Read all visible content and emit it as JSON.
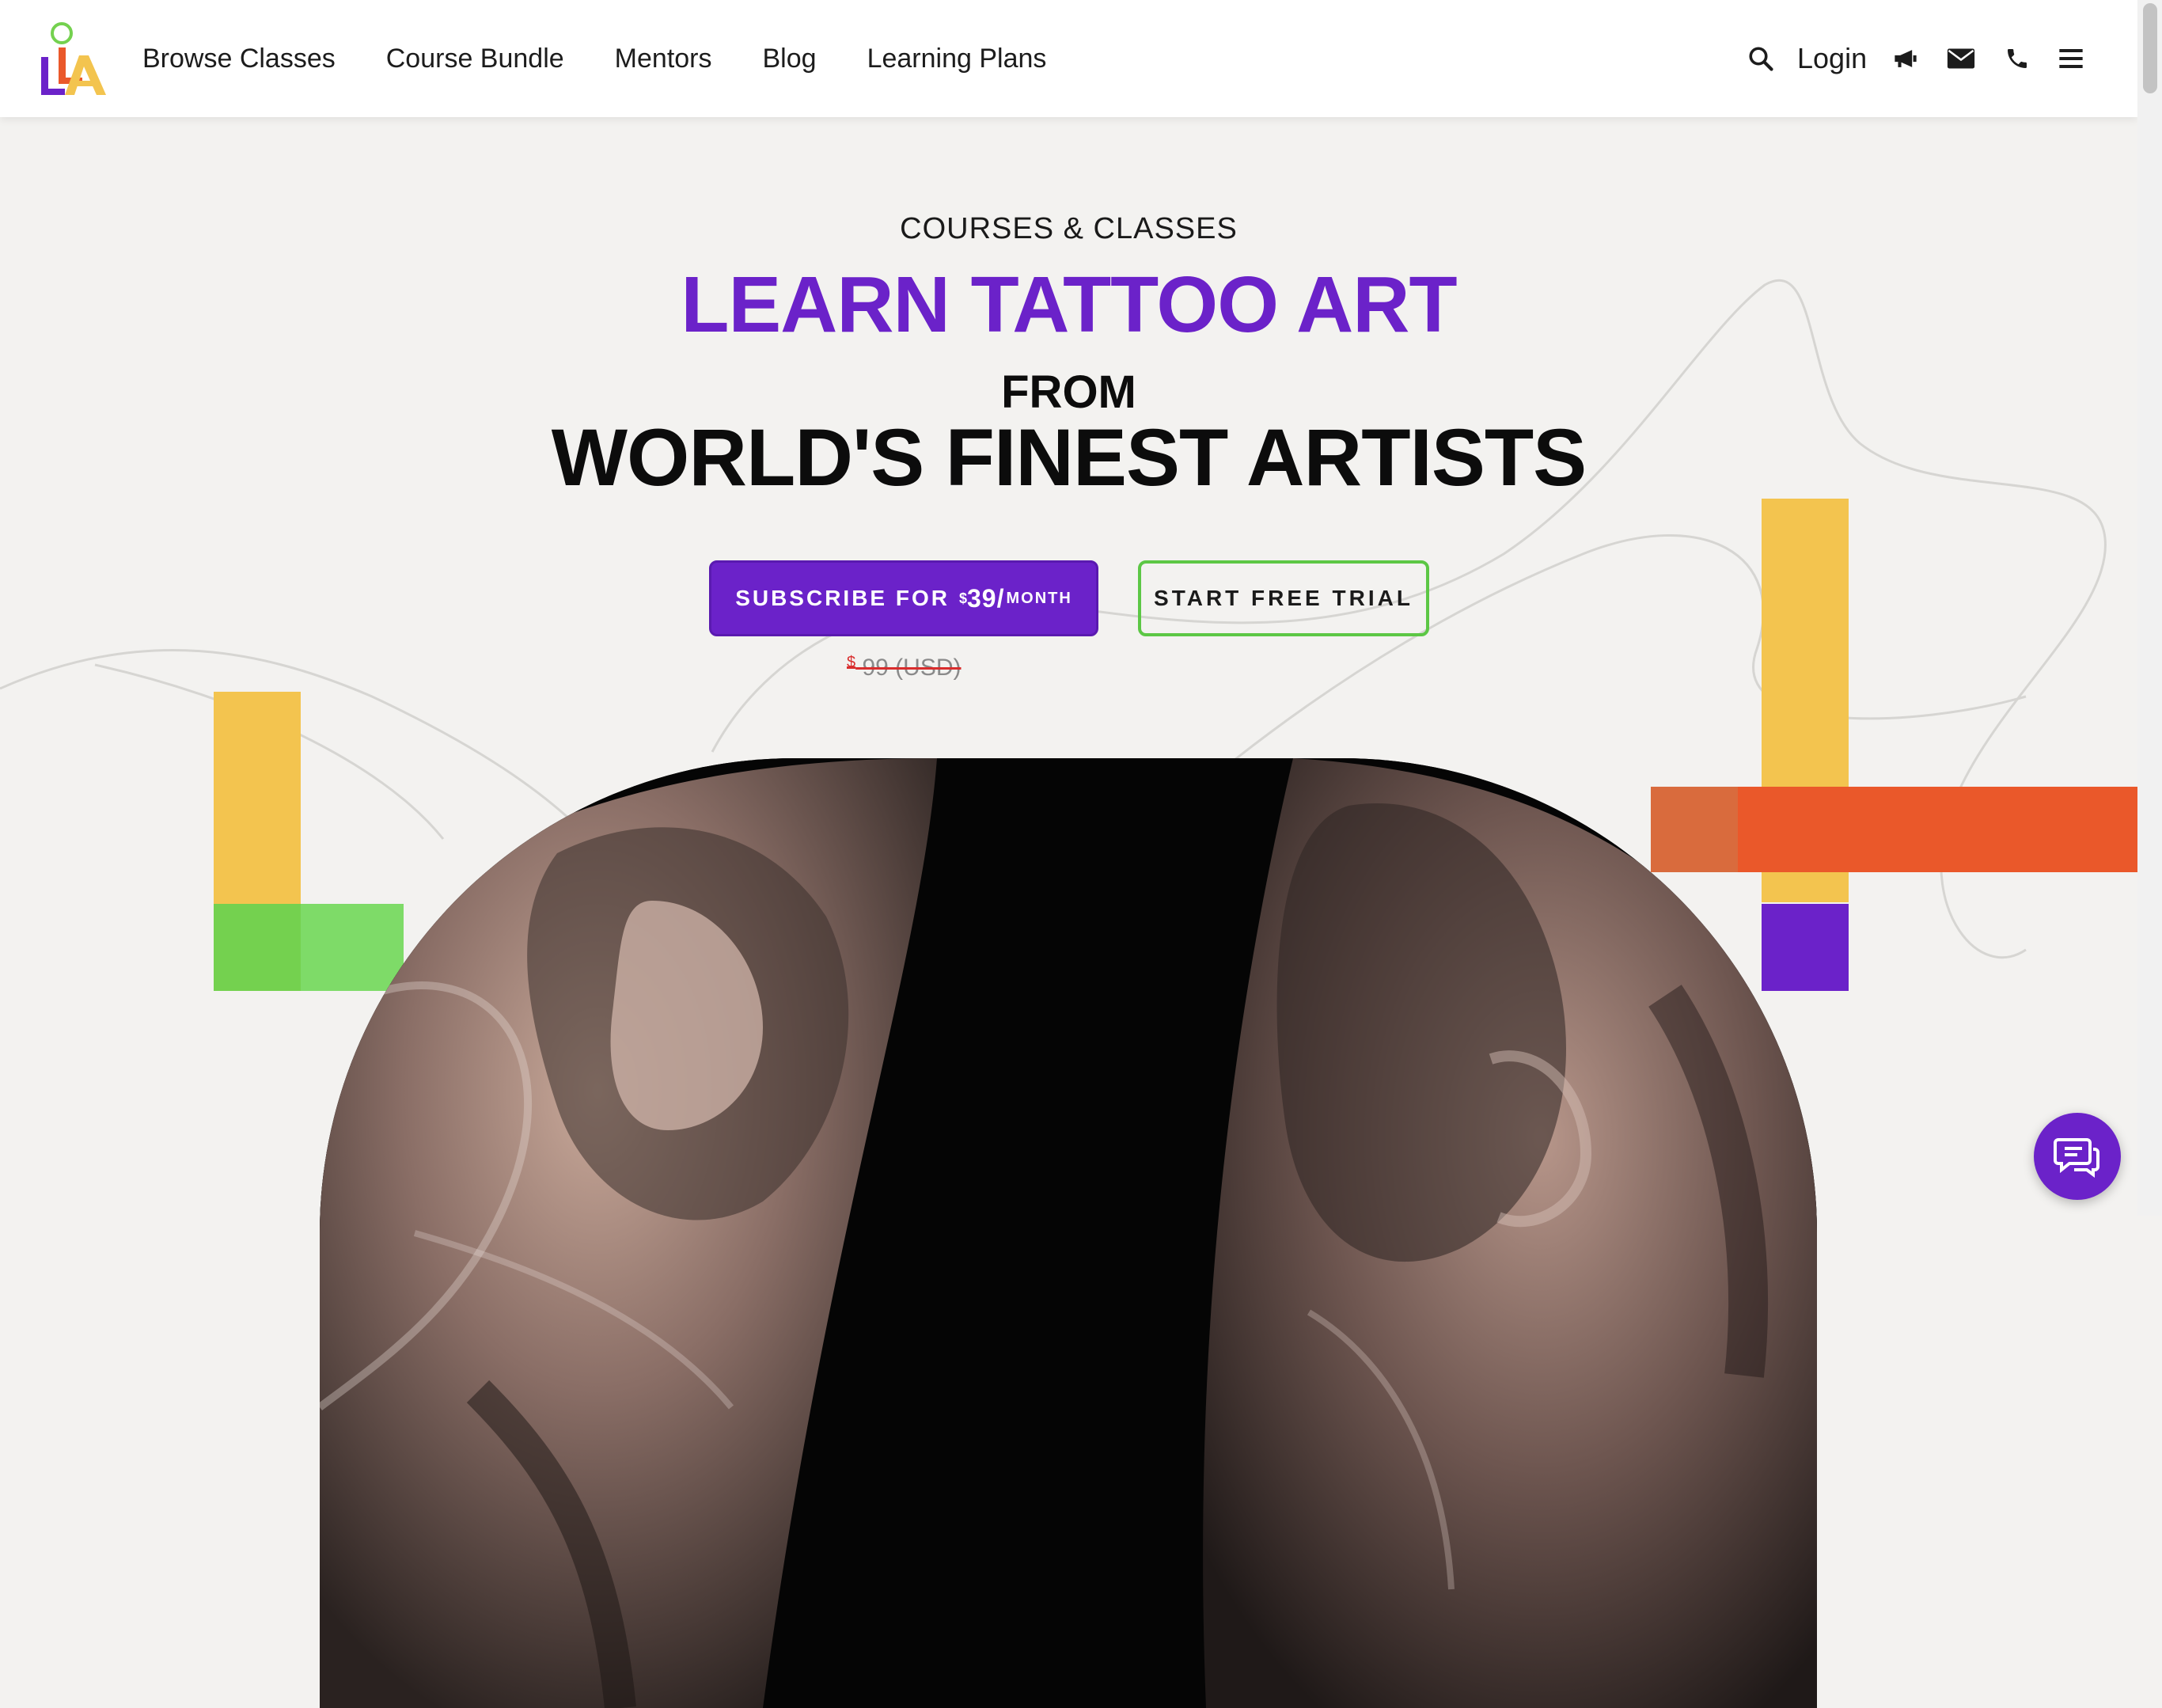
{
  "header": {
    "logo_icon": "lla-logo",
    "nav": [
      {
        "label": "Browse Classes"
      },
      {
        "label": "Course Bundle"
      },
      {
        "label": "Mentors"
      },
      {
        "label": "Blog"
      },
      {
        "label": "Learning Plans"
      }
    ],
    "login_label": "Login",
    "icons": [
      "search-icon",
      "megaphone-icon",
      "mail-icon",
      "phone-icon",
      "hamburger-menu-icon"
    ]
  },
  "hero": {
    "eyebrow": "COURSES & CLASSES",
    "headline_1": "LEARN TATTOO ART",
    "headline_2": "FROM",
    "headline_3": "WORLD'S FINEST ARTISTS",
    "subscribe": {
      "prefix": "SUBSCRIBE FOR",
      "currency": "$",
      "amount": "39/",
      "period": "MONTH"
    },
    "trial_label": "START FREE TRIAL",
    "old_price": {
      "currency": "$",
      "amount": "99 (USD)"
    }
  },
  "colors": {
    "purple": "#6b22c9",
    "yellow": "#f3c44f",
    "green": "#74d14f",
    "orange": "#ea582a",
    "background": "#f3f2f0"
  },
  "chat": {
    "icon": "chat-bubbles-icon"
  }
}
